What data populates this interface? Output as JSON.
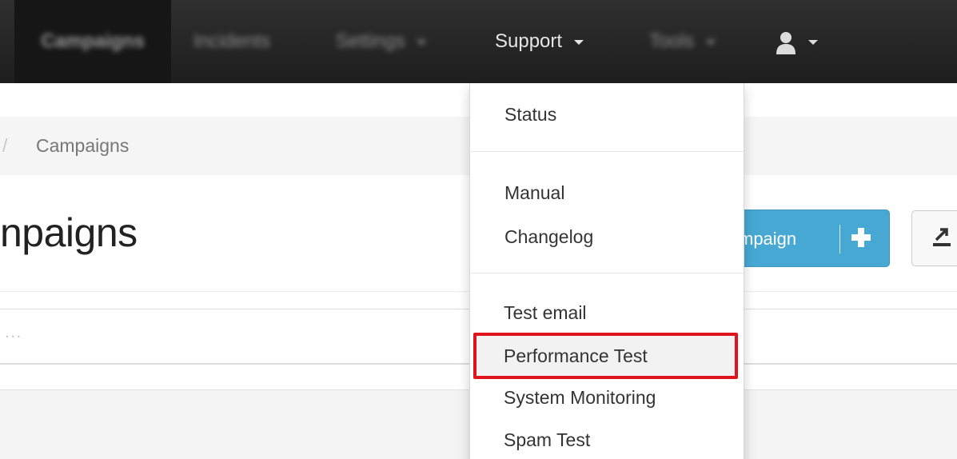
{
  "navbar": {
    "items": [
      {
        "label": "Campaigns"
      },
      {
        "label": "Incidents"
      },
      {
        "label": "Settings"
      },
      {
        "label": "Support"
      },
      {
        "label": "Tools"
      }
    ]
  },
  "breadcrumb": {
    "separator": "/",
    "current": "Campaigns"
  },
  "page": {
    "title": "npaigns"
  },
  "buttons": {
    "new_campaign_label": "mpaign"
  },
  "filter": {
    "placeholder": "..."
  },
  "support_menu": {
    "items": [
      {
        "label": "Status"
      },
      {
        "label": "Manual"
      },
      {
        "label": "Changelog"
      },
      {
        "label": "Test email"
      },
      {
        "label": "Performance Test",
        "highlighted": true
      },
      {
        "label": "System Monitoring"
      },
      {
        "label": "Spam Test"
      }
    ]
  },
  "colors": {
    "navbar": "#222222",
    "primary_button": "#46a8d3",
    "highlight": "#e0141c"
  }
}
